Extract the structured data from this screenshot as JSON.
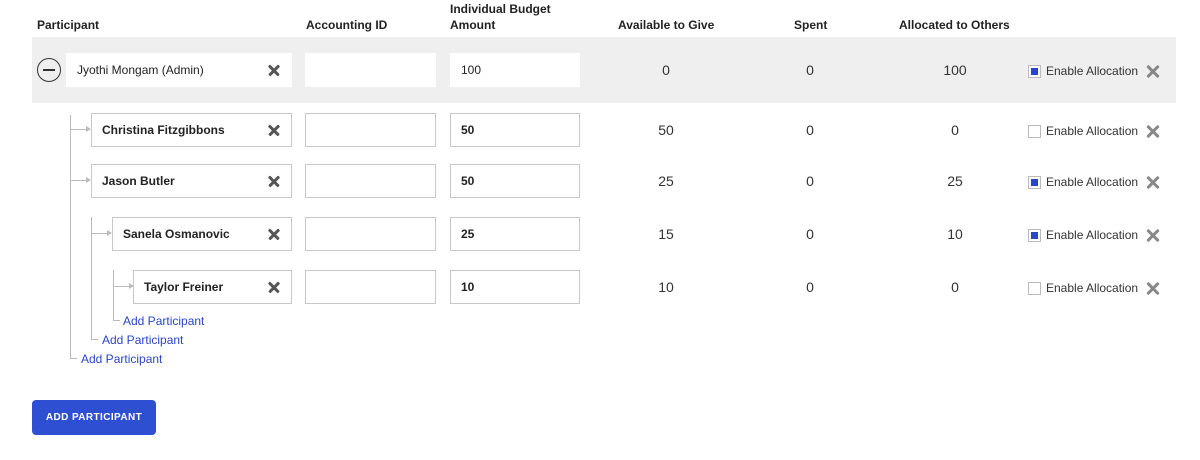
{
  "headers": {
    "participant": "Participant",
    "accounting_id": "Accounting ID",
    "budget_line1": "Individual Budget",
    "budget_line2": "Amount",
    "available": "Available to Give",
    "spent": "Spent",
    "allocated": "Allocated to Others"
  },
  "enable_label": "Enable Allocation",
  "rows": [
    {
      "name": "Jyothi Mongam (Admin)",
      "accounting_id": "",
      "budget": "100",
      "available": "0",
      "spent": "0",
      "allocated": "100",
      "enable_allocation": true
    },
    {
      "name": "Christina Fitzgibbons",
      "accounting_id": "",
      "budget": "50",
      "available": "50",
      "spent": "0",
      "allocated": "0",
      "enable_allocation": false
    },
    {
      "name": "Jason Butler",
      "accounting_id": "",
      "budget": "50",
      "available": "25",
      "spent": "0",
      "allocated": "25",
      "enable_allocation": true
    },
    {
      "name": "Sanela Osmanovic",
      "accounting_id": "",
      "budget": "25",
      "available": "15",
      "spent": "0",
      "allocated": "10",
      "enable_allocation": true
    },
    {
      "name": "Taylor Freiner",
      "accounting_id": "",
      "budget": "10",
      "available": "10",
      "spent": "0",
      "allocated": "0",
      "enable_allocation": false
    }
  ],
  "add_participant_link": "Add Participant",
  "add_participant_button": "ADD PARTICIPANT",
  "colors": {
    "accent": "#2f4fd3",
    "link": "#2a45c9",
    "admin_band": "#efefef"
  },
  "icons": {
    "collapse": "minus-circle-icon",
    "remove": "close-icon",
    "delete_row": "close-icon"
  }
}
